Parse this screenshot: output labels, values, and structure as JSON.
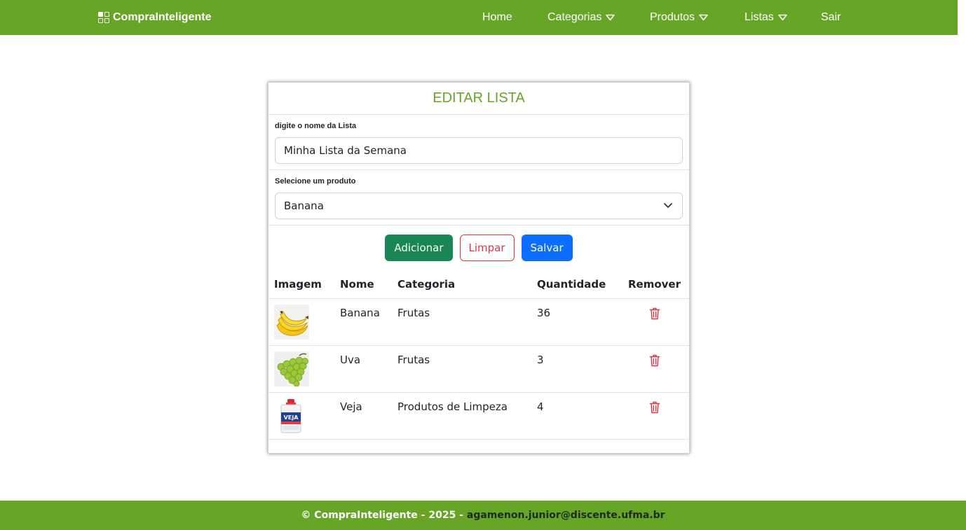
{
  "nav": {
    "brand": "CompraInteligente",
    "items": [
      {
        "label": "Home",
        "dropdown": false
      },
      {
        "label": "Categorias",
        "dropdown": true
      },
      {
        "label": "Produtos",
        "dropdown": true
      },
      {
        "label": "Listas",
        "dropdown": true
      },
      {
        "label": "Sair",
        "dropdown": false
      }
    ]
  },
  "card": {
    "title": "EDITAR LISTA",
    "name_label": "digite o nome da Lista",
    "name_value": "Minha Lista da Semana",
    "product_label": "Selecione um produto",
    "product_selected": "Banana"
  },
  "buttons": {
    "add": "Adicionar",
    "clear": "Limpar",
    "save": "Salvar"
  },
  "table": {
    "headers": [
      "Imagem",
      "Nome",
      "Categoria",
      "Quantidade",
      "Remover"
    ],
    "rows": [
      {
        "image": "banana-image",
        "name": "Banana",
        "category": "Frutas",
        "quantity": "36"
      },
      {
        "image": "grapes-image",
        "name": "Uva",
        "category": "Frutas",
        "quantity": "3"
      },
      {
        "image": "veja-cleaner-image",
        "name": "Veja",
        "category": "Produtos de Limpeza",
        "quantity": "4"
      }
    ]
  },
  "footer": {
    "text": "© CompraInteligente - 2025 - ",
    "email": "agamenon.junior@discente.ufma.br"
  },
  "colors": {
    "brand_green": "#67a526",
    "btn_add": "#198754",
    "btn_clear": "#dc3545",
    "btn_save": "#0d6efd",
    "trash": "#dc3545"
  }
}
